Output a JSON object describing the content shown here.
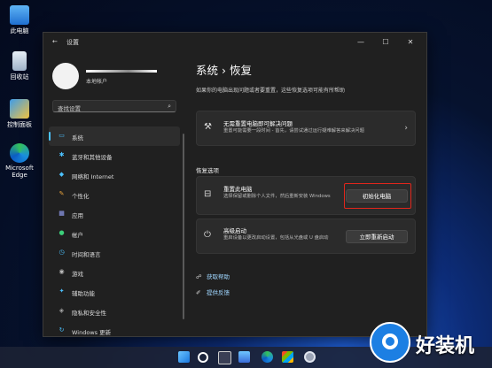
{
  "desktop": {
    "icons": [
      {
        "label": "此电脑",
        "icon": "computer-icon"
      },
      {
        "label": "回收站",
        "icon": "recycle-bin-icon"
      },
      {
        "label": "控制面板",
        "icon": "control-panel-icon"
      },
      {
        "label": "Microsoft Edge",
        "icon": "edge-icon"
      }
    ]
  },
  "window": {
    "title": "设置",
    "back": "←",
    "controls": {
      "minimize": "—",
      "maximize": "☐",
      "close": "✕"
    }
  },
  "profile": {
    "account": "本地帐户"
  },
  "search": {
    "placeholder": "查找设置",
    "icon": "⌕"
  },
  "nav": [
    {
      "label": "系统",
      "icon": "system-icon",
      "glyph": "▭",
      "color": "#4cc2ff"
    },
    {
      "label": "蓝牙和其他设备",
      "icon": "bluetooth-icon",
      "glyph": "✱",
      "color": "#4cc2ff"
    },
    {
      "label": "网络和 Internet",
      "icon": "network-icon",
      "glyph": "◆",
      "color": "#4cc2ff"
    },
    {
      "label": "个性化",
      "icon": "personalization-icon",
      "glyph": "✎",
      "color": "#e8a33c"
    },
    {
      "label": "应用",
      "icon": "apps-icon",
      "glyph": "▦",
      "color": "#9aa6ff"
    },
    {
      "label": "帐户",
      "icon": "accounts-icon",
      "glyph": "●",
      "color": "#3ccf7a"
    },
    {
      "label": "时间和语言",
      "icon": "time-language-icon",
      "glyph": "◷",
      "color": "#4cc2ff"
    },
    {
      "label": "游戏",
      "icon": "gaming-icon",
      "glyph": "◉",
      "color": "#bbbbbb"
    },
    {
      "label": "辅助功能",
      "icon": "accessibility-icon",
      "glyph": "✦",
      "color": "#4cc2ff"
    },
    {
      "label": "隐私和安全性",
      "icon": "privacy-icon",
      "glyph": "◈",
      "color": "#aaaaaa"
    },
    {
      "label": "Windows 更新",
      "icon": "windows-update-icon",
      "glyph": "↻",
      "color": "#4cc2ff"
    }
  ],
  "page": {
    "breadcrumb": "系统  ›  恢复",
    "description": "如果你的电脑出现问题或者要重置，这些恢复选项可能有所帮助"
  },
  "fix_card": {
    "title": "无需重置电脑即可解决问题",
    "description": "重置可能需要一段时间 - 首先，请尝试通过运行疑难解答来解决问题",
    "icon": "wrench-icon",
    "glyph": "⚒",
    "chevron": "›"
  },
  "section_title": "恢复选项",
  "reset_card": {
    "title": "重置此电脑",
    "description": "选择保留或删除个人文件，然后重新安装 Windows",
    "button": "初始化电脑",
    "icon": "reset-pc-icon",
    "glyph": "⊟"
  },
  "advanced_card": {
    "title": "高级启动",
    "description": "重启设备以更改启动设置，包括从光盘或 U 盘启动",
    "button": "立即重新启动",
    "icon": "advanced-startup-icon",
    "glyph": "⏻"
  },
  "links": [
    {
      "label": "获取帮助",
      "icon": "help-icon",
      "glyph": "☍"
    },
    {
      "label": "提供反馈",
      "icon": "feedback-icon",
      "glyph": "✐"
    }
  ],
  "brand": {
    "text": "好装机",
    "icon": "haozhuangji-logo-icon"
  },
  "colors": {
    "accent": "#4cc2ff",
    "highlight": "#e1261c",
    "window_bg": "#202020",
    "card_bg": "#2b2b2b"
  }
}
